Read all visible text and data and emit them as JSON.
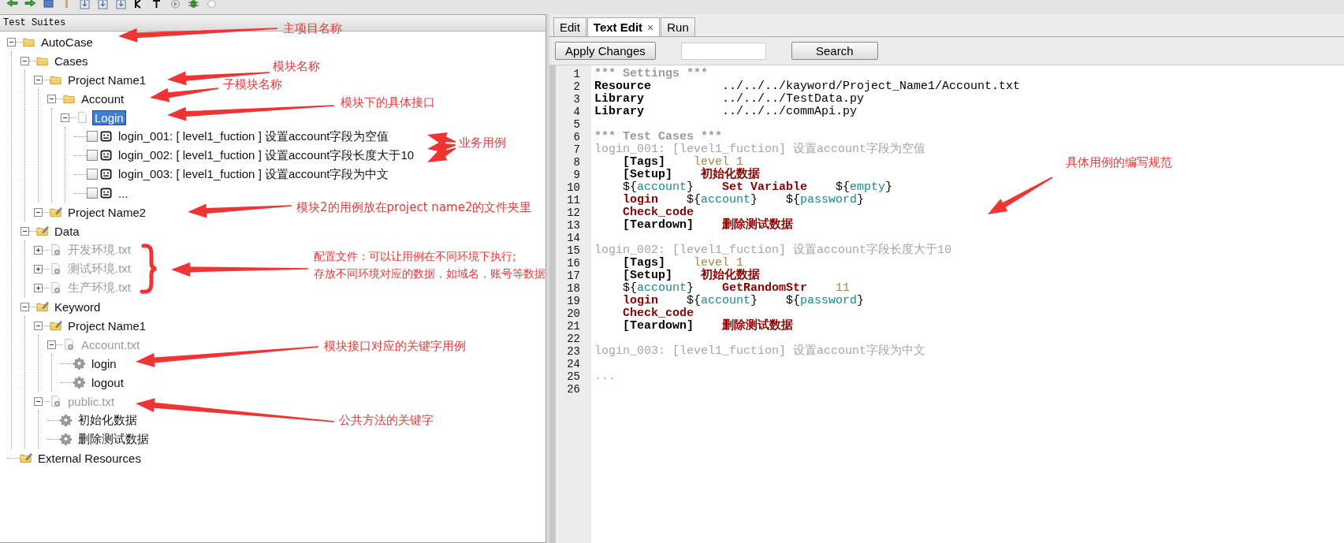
{
  "left_panel": {
    "title": "Test Suites",
    "tree": [
      {
        "label": "AutoCase",
        "kind": "folder",
        "expanded": true,
        "selected": false,
        "children": [
          {
            "label": "Cases",
            "kind": "folder",
            "expanded": true,
            "selected": false,
            "children": [
              {
                "label": "Project Name1",
                "kind": "folder",
                "expanded": true,
                "selected": false,
                "children": [
                  {
                    "label": "Account",
                    "kind": "folder",
                    "expanded": true,
                    "selected": false,
                    "children": [
                      {
                        "label": "Login",
                        "kind": "suite-file",
                        "expanded": true,
                        "selected": true,
                        "children": [
                          {
                            "label": "login_001: [ level1_fuction ] 设置account字段为空值",
                            "kind": "test",
                            "checked": false,
                            "selected": false
                          },
                          {
                            "label": "login_002: [ level1_fuction ] 设置account字段长度大于10",
                            "kind": "test",
                            "checked": false,
                            "selected": false
                          },
                          {
                            "label": "login_003: [ level1_fuction ] 设置account字段为中文",
                            "kind": "test",
                            "checked": false,
                            "selected": false
                          },
                          {
                            "label": "...",
                            "kind": "test",
                            "checked": false,
                            "selected": false
                          }
                        ]
                      }
                    ]
                  }
                ]
              },
              {
                "label": "Project Name2",
                "kind": "resource-folder",
                "expanded": true,
                "selected": false
              }
            ]
          },
          {
            "label": "Data",
            "kind": "resource-folder",
            "expanded": true,
            "selected": false,
            "children": [
              {
                "label": "开发环境.txt",
                "kind": "resource-file",
                "expanded": false,
                "selected": false
              },
              {
                "label": "测试环境.txt",
                "kind": "resource-file",
                "expanded": false,
                "selected": false
              },
              {
                "label": "生产环境.txt",
                "kind": "resource-file",
                "expanded": false,
                "selected": false
              }
            ]
          },
          {
            "label": "Keyword",
            "kind": "resource-folder",
            "expanded": true,
            "selected": false,
            "children": [
              {
                "label": "Project Name1",
                "kind": "resource-folder",
                "expanded": true,
                "selected": false,
                "children": [
                  {
                    "label": "Account.txt",
                    "kind": "resource-file",
                    "expanded": true,
                    "selected": false,
                    "children": [
                      {
                        "label": "login",
                        "kind": "keyword",
                        "selected": false
                      },
                      {
                        "label": "logout",
                        "kind": "keyword",
                        "selected": false
                      }
                    ]
                  }
                ]
              },
              {
                "label": "public.txt",
                "kind": "resource-file",
                "expanded": true,
                "selected": false,
                "children": [
                  {
                    "label": "初始化数据",
                    "kind": "keyword",
                    "selected": false
                  },
                  {
                    "label": "删除测试数据",
                    "kind": "keyword",
                    "selected": false
                  }
                ]
              }
            ]
          }
        ]
      },
      {
        "label": "External Resources",
        "kind": "resource-folder",
        "selected": false
      }
    ]
  },
  "right_panel": {
    "tabs": [
      {
        "label": "Edit",
        "selected": false
      },
      {
        "label": "Text Edit",
        "selected": true,
        "close": "×"
      },
      {
        "label": "Run",
        "selected": false
      }
    ],
    "apply_button": "Apply Changes",
    "search_button": "Search",
    "editor": [
      {
        "number": "1",
        "tokens": [
          {
            "text": "*** Settings ***",
            "kind": "section"
          }
        ]
      },
      {
        "number": "2",
        "tokens": [
          {
            "text": "Resource",
            "kind": "setting"
          },
          {
            "text": "          ../../../kayword/Project_Name1/Account.txt",
            "kind": "text"
          }
        ]
      },
      {
        "number": "3",
        "tokens": [
          {
            "text": "Library",
            "kind": "setting"
          },
          {
            "text": "           ../../../TestData.py",
            "kind": "text"
          }
        ]
      },
      {
        "number": "4",
        "tokens": [
          {
            "text": "Library",
            "kind": "setting"
          },
          {
            "text": "           ../../../commApi.py",
            "kind": "text"
          }
        ]
      },
      {
        "number": "5"
      },
      {
        "number": "6",
        "tokens": [
          {
            "text": "*** Test Cases ***",
            "kind": "section"
          }
        ]
      },
      {
        "number": "7",
        "tokens": [
          {
            "text": "login_001: [level1_fuction] 设置account字段为空值",
            "kind": "comment"
          }
        ]
      },
      {
        "number": "8",
        "tokens": [
          {
            "text": "    [Tags]",
            "kind": "setting"
          },
          {
            "text": "    level 1",
            "kind": "argument"
          }
        ]
      },
      {
        "number": "9",
        "tokens": [
          {
            "text": "    [Setup]",
            "kind": "setting"
          },
          {
            "text": "    初始化数据",
            "kind": "keyword"
          }
        ]
      },
      {
        "number": "10",
        "tokens": [
          {
            "text": "    ${",
            "kind": "text"
          },
          {
            "text": "account",
            "kind": "variable"
          },
          {
            "text": "}",
            "kind": "text"
          },
          {
            "text": "    Set Variable",
            "kind": "keyword"
          },
          {
            "text": "    ${",
            "kind": "text"
          },
          {
            "text": "empty",
            "kind": "variable"
          },
          {
            "text": "}",
            "kind": "text"
          }
        ]
      },
      {
        "number": "11",
        "tokens": [
          {
            "text": "    login",
            "kind": "keyword"
          },
          {
            "text": "    ${",
            "kind": "text"
          },
          {
            "text": "account",
            "kind": "variable"
          },
          {
            "text": "}",
            "kind": "text"
          },
          {
            "text": "    ${",
            "kind": "text"
          },
          {
            "text": "password",
            "kind": "variable"
          },
          {
            "text": "}",
            "kind": "text"
          }
        ]
      },
      {
        "number": "12",
        "tokens": [
          {
            "text": "    Check_code",
            "kind": "keyword"
          }
        ]
      },
      {
        "number": "13",
        "tokens": [
          {
            "text": "    [Teardown]",
            "kind": "setting"
          },
          {
            "text": "    删除测试数据",
            "kind": "keyword"
          }
        ]
      },
      {
        "number": "14"
      },
      {
        "number": "15",
        "tokens": [
          {
            "text": "login_002: [level1_fuction] 设置account字段长度大于10",
            "kind": "comment"
          }
        ]
      },
      {
        "number": "16",
        "tokens": [
          {
            "text": "    [Tags]",
            "kind": "setting"
          },
          {
            "text": "    level 1",
            "kind": "argument"
          }
        ]
      },
      {
        "number": "17",
        "tokens": [
          {
            "text": "    [Setup]",
            "kind": "setting"
          },
          {
            "text": "    初始化数据",
            "kind": "keyword"
          }
        ]
      },
      {
        "number": "18",
        "tokens": [
          {
            "text": "    ${",
            "kind": "text"
          },
          {
            "text": "account",
            "kind": "variable"
          },
          {
            "text": "}",
            "kind": "text"
          },
          {
            "text": "    GetRandomStr",
            "kind": "keyword"
          },
          {
            "text": "    11",
            "kind": "argument"
          }
        ]
      },
      {
        "number": "19",
        "tokens": [
          {
            "text": "    login",
            "kind": "keyword"
          },
          {
            "text": "    ${",
            "kind": "text"
          },
          {
            "text": "account",
            "kind": "variable"
          },
          {
            "text": "}",
            "kind": "text"
          },
          {
            "text": "    ${",
            "kind": "text"
          },
          {
            "text": "password",
            "kind": "variable"
          },
          {
            "text": "}",
            "kind": "text"
          }
        ]
      },
      {
        "number": "20",
        "tokens": [
          {
            "text": "    Check_code",
            "kind": "keyword"
          }
        ]
      },
      {
        "number": "21",
        "tokens": [
          {
            "text": "    [Teardown]",
            "kind": "setting"
          },
          {
            "text": "    删除测试数据",
            "kind": "keyword"
          }
        ]
      },
      {
        "number": "22"
      },
      {
        "number": "23",
        "tokens": [
          {
            "text": "login_003: [level1_fuction] 设置account字段为中文",
            "kind": "comment"
          }
        ]
      },
      {
        "number": "24"
      },
      {
        "number": "25",
        "tokens": [
          {
            "text": "...",
            "kind": "comment"
          }
        ]
      },
      {
        "number": "26"
      }
    ]
  },
  "annotations": [
    {
      "text": "主项目名称"
    },
    {
      "text": "模块名称"
    },
    {
      "text": "子模块名称"
    },
    {
      "text": "模块下的具体接口"
    },
    {
      "text": "业务用例"
    },
    {
      "text": "模块2的用例放在project name2的文件夹里"
    },
    {
      "text": "配置文件：可以让用例在不同环境下执行;"
    },
    {
      "text": "存放不同环境对应的数据，如域名，账号等数据"
    },
    {
      "text": "模块接口对应的关键字用例"
    },
    {
      "text": "公共方法的关键字"
    },
    {
      "text": "具体用例的编写规范"
    }
  ]
}
